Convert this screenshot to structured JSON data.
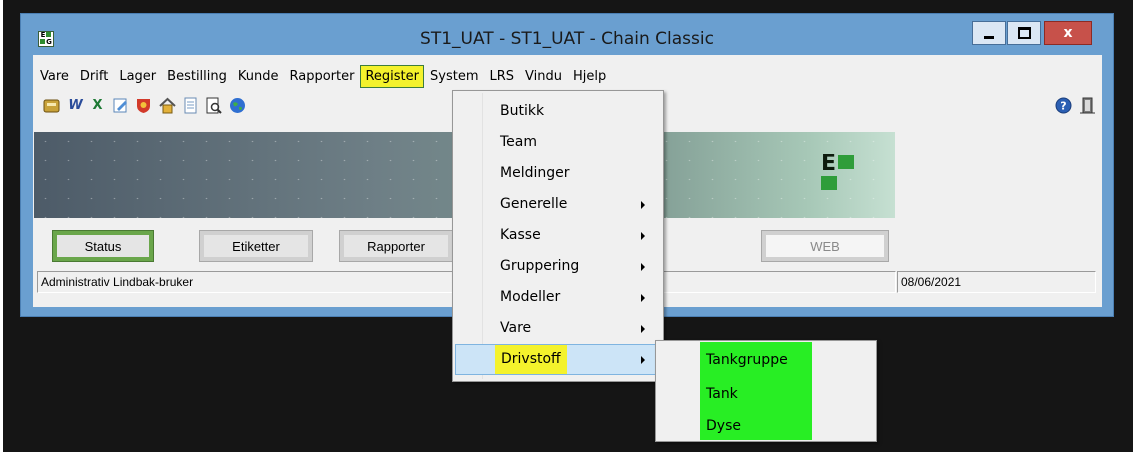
{
  "window": {
    "title": "ST1_UAT  -  ST1_UAT  -  Chain Classic",
    "close_label": "x"
  },
  "menubar": [
    "Vare",
    "Drift",
    "Lager",
    "Bestilling",
    "Kunde",
    "Rapporter",
    "Register",
    "System",
    "LRS",
    "Vindu",
    "Hjelp"
  ],
  "active_menu": "Register",
  "toolbar_icons": [
    "calculator-icon",
    "word-icon",
    "excel-icon",
    "edit-icon",
    "shield-icon",
    "home-icon",
    "document-icon",
    "print-preview-icon",
    "globe-icon",
    "help-icon",
    "exit-door-icon"
  ],
  "buttons": {
    "status": "Status",
    "etiketter": "Etiketter",
    "rapporter": "Rapporter",
    "web": "WEB"
  },
  "statusbar": {
    "user": "Administrativ Lindbak-bruker",
    "date": "08/06/2021"
  },
  "register_menu": {
    "items": [
      {
        "label": "Butikk",
        "submenu": false
      },
      {
        "label": "Team",
        "submenu": false
      },
      {
        "label": "Meldinger",
        "submenu": false
      },
      {
        "label": "Generelle",
        "submenu": true
      },
      {
        "label": "Kasse",
        "submenu": true
      },
      {
        "label": "Gruppering",
        "submenu": true
      },
      {
        "label": "Modeller",
        "submenu": true
      },
      {
        "label": "Vare",
        "submenu": true
      },
      {
        "label": "Drivstoff",
        "submenu": true,
        "highlighted": true
      }
    ]
  },
  "drivstoff_submenu": {
    "items": [
      "Tankgruppe",
      "Tank",
      "Dyse"
    ]
  },
  "colors": {
    "highlight_yellow": "#f4f22c",
    "highlight_green": "#28ee24",
    "hover_blue": "#cce4f7",
    "frame_blue": "#6a9fd0"
  },
  "logo_text": "EG"
}
